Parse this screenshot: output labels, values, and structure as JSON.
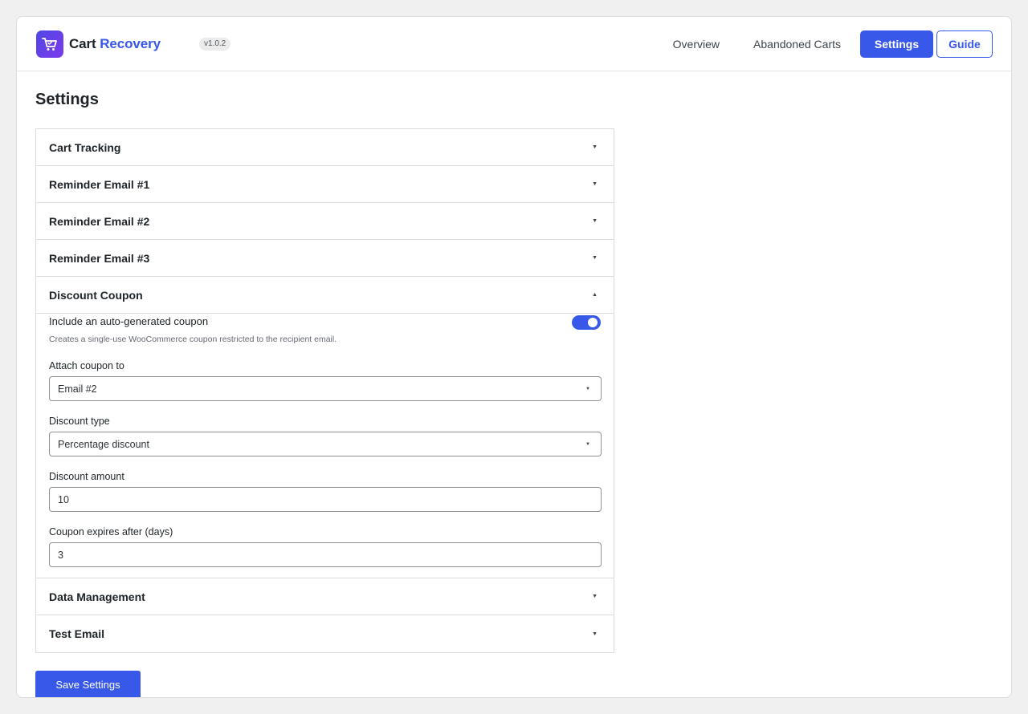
{
  "header": {
    "brand_part1": "Cart",
    "brand_part2": "Recovery",
    "version": "v1.0.2",
    "nav": {
      "overview": "Overview",
      "abandoned_carts": "Abandoned Carts",
      "settings": "Settings",
      "guide": "Guide"
    },
    "colors": {
      "accent": "#3858e9",
      "logo_gradient_start": "#4f46e5",
      "logo_gradient_end": "#7c3aed"
    },
    "logo_icon": "shopping-cart-icon"
  },
  "page": {
    "title": "Settings"
  },
  "sections": {
    "cart_tracking": {
      "title": "Cart Tracking",
      "expanded": false
    },
    "reminder_1": {
      "title": "Reminder Email #1",
      "expanded": false
    },
    "reminder_2": {
      "title": "Reminder Email #2",
      "expanded": false
    },
    "reminder_3": {
      "title": "Reminder Email #3",
      "expanded": false
    },
    "discount_coupon": {
      "title": "Discount Coupon",
      "expanded": true,
      "toggle_label": "Include an auto-generated coupon",
      "toggle_on": true,
      "toggle_help": "Creates a single-use WooCommerce coupon restricted to the recipient email.",
      "attach_label": "Attach coupon to",
      "attach_value": "Email #2",
      "type_label": "Discount type",
      "type_value": "Percentage discount",
      "amount_label": "Discount amount",
      "amount_value": "10",
      "expires_label": "Coupon expires after (days)",
      "expires_value": "3"
    },
    "data_management": {
      "title": "Data Management",
      "expanded": false
    },
    "test_email": {
      "title": "Test Email",
      "expanded": false
    }
  },
  "icons": {
    "collapsed": "▼",
    "expanded": "▲",
    "select": "▼"
  },
  "actions": {
    "save_label": "Save Settings"
  }
}
